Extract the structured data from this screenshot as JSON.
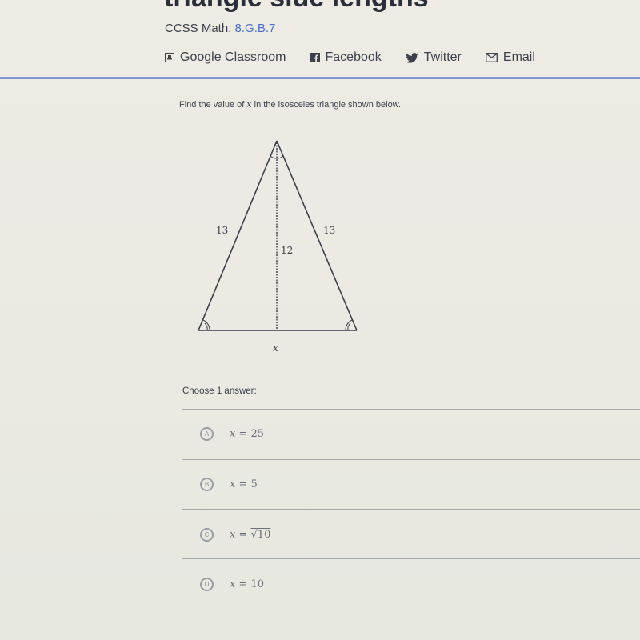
{
  "header": {
    "title": "triangle side lengths",
    "standard_prefix": "CCSS Math:",
    "standard_code": "8.G.B.7",
    "share": [
      {
        "icon": "google-classroom-icon",
        "label": "Google Classroom"
      },
      {
        "icon": "facebook-icon",
        "label": "Facebook"
      },
      {
        "icon": "twitter-icon",
        "label": "Twitter"
      },
      {
        "icon": "email-icon",
        "label": "Email"
      }
    ]
  },
  "question": {
    "prefix": "Find the value of ",
    "variable": "x",
    "suffix": " in the isosceles triangle shown below."
  },
  "figure": {
    "left_side": "13",
    "right_side": "13",
    "height": "12",
    "base": "x"
  },
  "answers": {
    "prompt": "Choose 1 answer:",
    "options": [
      {
        "letter": "A",
        "lhs": "x",
        "rhs": "25"
      },
      {
        "letter": "B",
        "lhs": "x",
        "rhs": "5"
      },
      {
        "letter": "C",
        "lhs": "x",
        "rhs": "√10"
      },
      {
        "letter": "D",
        "lhs": "x",
        "rhs": "10"
      }
    ]
  },
  "colors": {
    "accent": "#4a6fcf",
    "divider": "#7f98cf"
  }
}
